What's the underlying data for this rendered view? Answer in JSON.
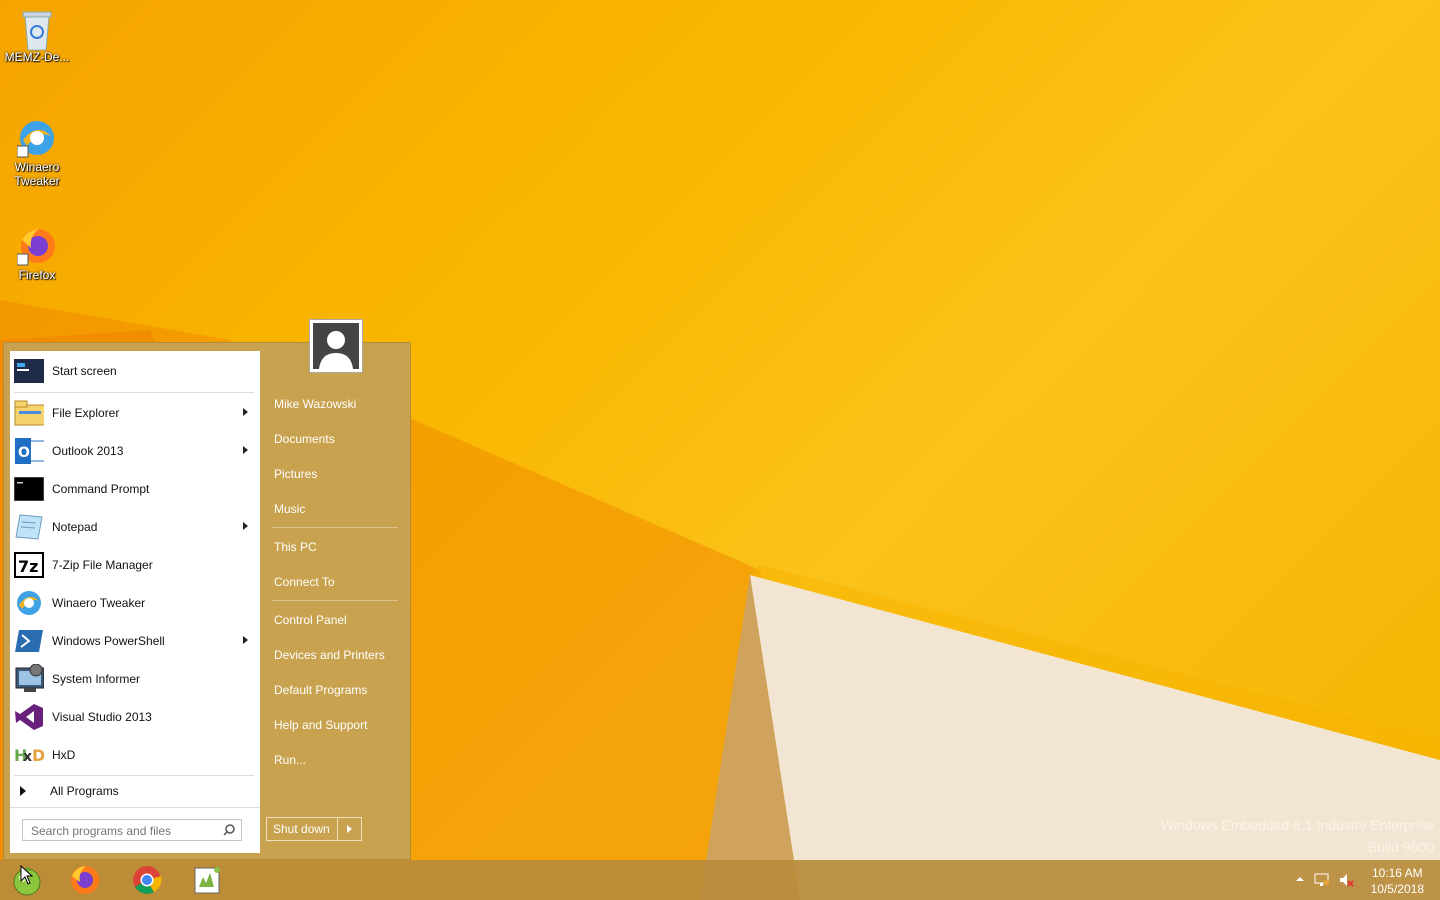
{
  "desktop": {
    "icons": [
      {
        "label": "MEMZ-De...",
        "icon": "recycle-bin-icon"
      },
      {
        "label": "Winaero\nTweaker",
        "icon": "winaero-icon"
      },
      {
        "label": "Firefox",
        "icon": "firefox-icon"
      }
    ],
    "watermark": {
      "line1": "Windows Embedded 8.1 Industry Enterprise",
      "line2": "Build 9600"
    }
  },
  "start_menu": {
    "programs": [
      {
        "label": "Start screen",
        "icon": "start-screen-icon",
        "has_submenu": false
      },
      {
        "label": "File Explorer",
        "icon": "file-explorer-icon",
        "has_submenu": true
      },
      {
        "label": "Outlook 2013",
        "icon": "outlook-icon",
        "has_submenu": true
      },
      {
        "label": "Command Prompt",
        "icon": "command-prompt-icon",
        "has_submenu": false
      },
      {
        "label": "Notepad",
        "icon": "notepad-icon",
        "has_submenu": true
      },
      {
        "label": "7-Zip File Manager",
        "icon": "7zip-icon",
        "has_submenu": false
      },
      {
        "label": "Winaero Tweaker",
        "icon": "winaero-icon",
        "has_submenu": false
      },
      {
        "label": "Windows PowerShell",
        "icon": "powershell-icon",
        "has_submenu": true
      },
      {
        "label": "System Informer",
        "icon": "system-informer-icon",
        "has_submenu": false
      },
      {
        "label": "Visual Studio 2013",
        "icon": "visual-studio-icon",
        "has_submenu": false
      },
      {
        "label": "HxD",
        "icon": "hxd-icon",
        "has_submenu": false
      }
    ],
    "all_programs": "All Programs",
    "search_placeholder": "Search programs and files",
    "user": "Mike Wazowski",
    "right_items": [
      "Documents",
      "Pictures",
      "Music",
      "This PC",
      "Connect To",
      "Control Panel",
      "Devices and Printers",
      "Default Programs",
      "Help and Support",
      "Run..."
    ],
    "shutdown_label": "Shut down"
  },
  "taskbar": {
    "pinned": [
      "start-orb-icon",
      "firefox-icon",
      "chrome-icon",
      "notepad-plus-icon"
    ],
    "clock_time": "10:16 AM",
    "clock_date": "10/5/2018"
  }
}
